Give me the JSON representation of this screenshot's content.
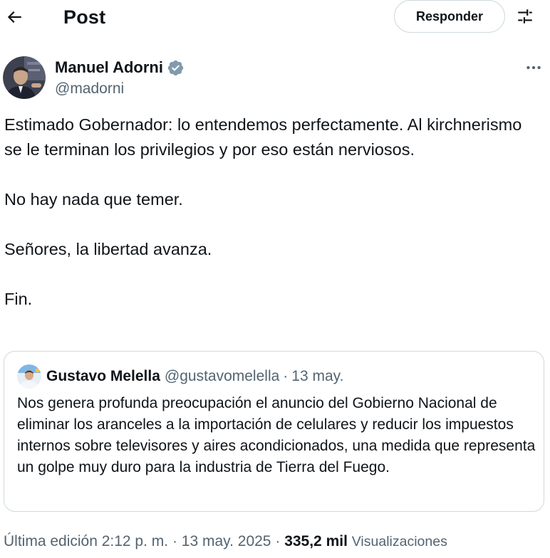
{
  "header": {
    "title": "Post",
    "reply_label": "Responder",
    "back_icon": "arrow-left-icon",
    "filter_icon": "sliders-icon"
  },
  "author": {
    "name": "Manuel Adorni",
    "handle": "@madorni",
    "verified": true,
    "verified_color": "#829aab"
  },
  "tweet": {
    "paragraphs": [
      "Estimado Gobernador: lo entendemos perfectamente. Al kirchnerismo se le terminan los privilegios y por eso están nerviosos.",
      "No hay nada que temer.",
      "Señores, la libertad avanza.",
      "Fin."
    ]
  },
  "quote": {
    "name": "Gustavo Melella",
    "handle": "@gustavomelella",
    "separator": "·",
    "date": "13 may.",
    "text": "Nos genera profunda preocupación el anuncio del Gobierno Nacional de eliminar los aranceles a la importación de celulares y reducir los impuestos internos sobre televisores y aires acondicionados, una medida que representa un golpe muy duro para la industria de Tierra del Fuego."
  },
  "meta": {
    "edited_prefix": "Última edición 2:12 p. m.",
    "separator": "·",
    "date": "13 may. 2025",
    "views_count": "335,2 mil",
    "views_label": "Visualizaciones"
  },
  "colors": {
    "text_primary": "#0f1419",
    "text_secondary": "#536471",
    "border": "#cfd9de"
  }
}
